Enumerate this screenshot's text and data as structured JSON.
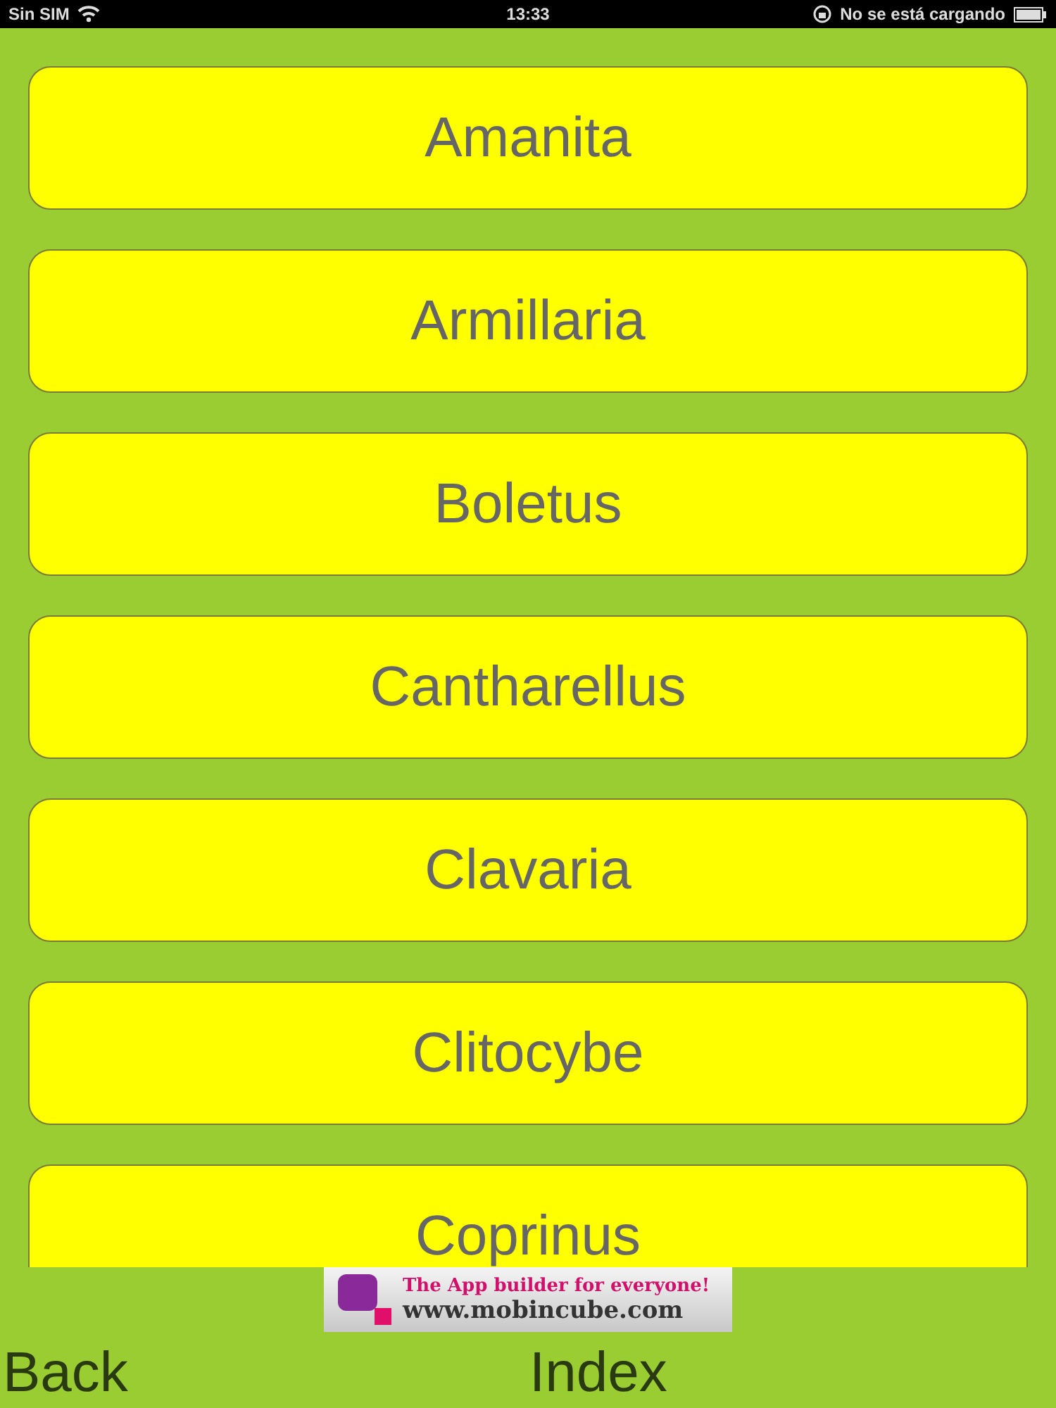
{
  "status_bar": {
    "carrier": "Sin SIM",
    "time": "13:33",
    "battery_text": "No se está cargando"
  },
  "items": [
    {
      "label": "Amanita"
    },
    {
      "label": "Armillaria"
    },
    {
      "label": "Boletus"
    },
    {
      "label": "Cantharellus"
    },
    {
      "label": "Clavaria"
    },
    {
      "label": "Clitocybe"
    },
    {
      "label": "Coprinus"
    }
  ],
  "ad_banner": {
    "tagline": "The App builder for everyone!",
    "url": "www.mobincube.com"
  },
  "footer": {
    "back": "Back",
    "index": "Index"
  }
}
